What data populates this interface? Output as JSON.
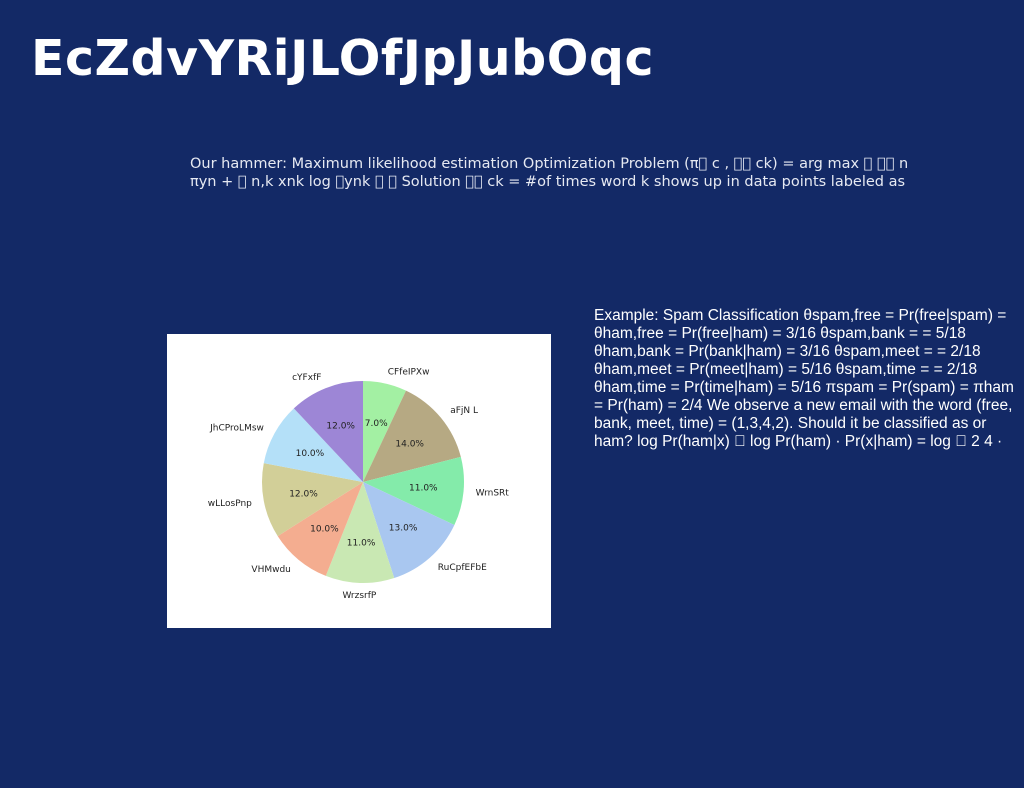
{
  "slide": {
    "title": "EcZdvYRiJLOfJpJubOqc",
    "body": "Our hammer: Maximum likelihood estimation Optimization Problem (π\u0000 c , \u0000\u0000 ck) = arg max \u0000 \u0000\u0000 n πyn + \u0000 n,k xnk log \u0000ynk \u0000 \u0000 Solution \u0000\u0000 ck = #of times word k shows up in data points labeled as",
    "example": "Example: Spam Classification θspam,free = Pr(free|spam) = θham,free = Pr(free|ham) = 3/16 θspam,bank = = 5/18 θham,bank = Pr(bank|ham) = 3/16 θspam,meet = = 2/18 θham,meet = Pr(meet|ham) = 5/16 θspam,time = = 2/18 θham,time = Pr(time|ham) = 5/16 πspam = Pr(spam) = πham = Pr(ham) = 2/4 We observe a new email with the word (free, bank, meet, time) = (1,3,4,2). Should it be classified as or ham? log Pr(ham|x) \u0000 log Pr(ham) · Pr(x|ham) = log \u0000 2 4 ·"
  },
  "chart_data": {
    "type": "pie",
    "start_angle_deg": 90,
    "direction": "clockwise",
    "slices": [
      {
        "label": "CFfeIPXw",
        "value": 7.0,
        "pct_label": "7.0%",
        "color": "#a3f0a3"
      },
      {
        "label": "aFjN L",
        "value": 14.0,
        "pct_label": "14.0%",
        "color": "#b6a983"
      },
      {
        "label": "WrnSRt",
        "value": 11.0,
        "pct_label": "11.0%",
        "color": "#84ebaa"
      },
      {
        "label": "RuCpfEFbE",
        "value": 13.0,
        "pct_label": "13.0%",
        "color": "#a9c7f0"
      },
      {
        "label": "WrzsrfP",
        "value": 11.0,
        "pct_label": "11.0%",
        "color": "#c9e8b3"
      },
      {
        "label": "VHMwdu",
        "value": 10.0,
        "pct_label": "10.0%",
        "color": "#f4ad90"
      },
      {
        "label": "wLLosPnp",
        "value": 12.0,
        "pct_label": "12.0%",
        "color": "#d2cf98"
      },
      {
        "label": "JhCProLMsw",
        "value": 10.0,
        "pct_label": "10.0%",
        "color": "#b4e0f8"
      },
      {
        "label": "cYFxfF",
        "value": 12.0,
        "pct_label": "12.0%",
        "color": "#9d86d6"
      }
    ]
  }
}
